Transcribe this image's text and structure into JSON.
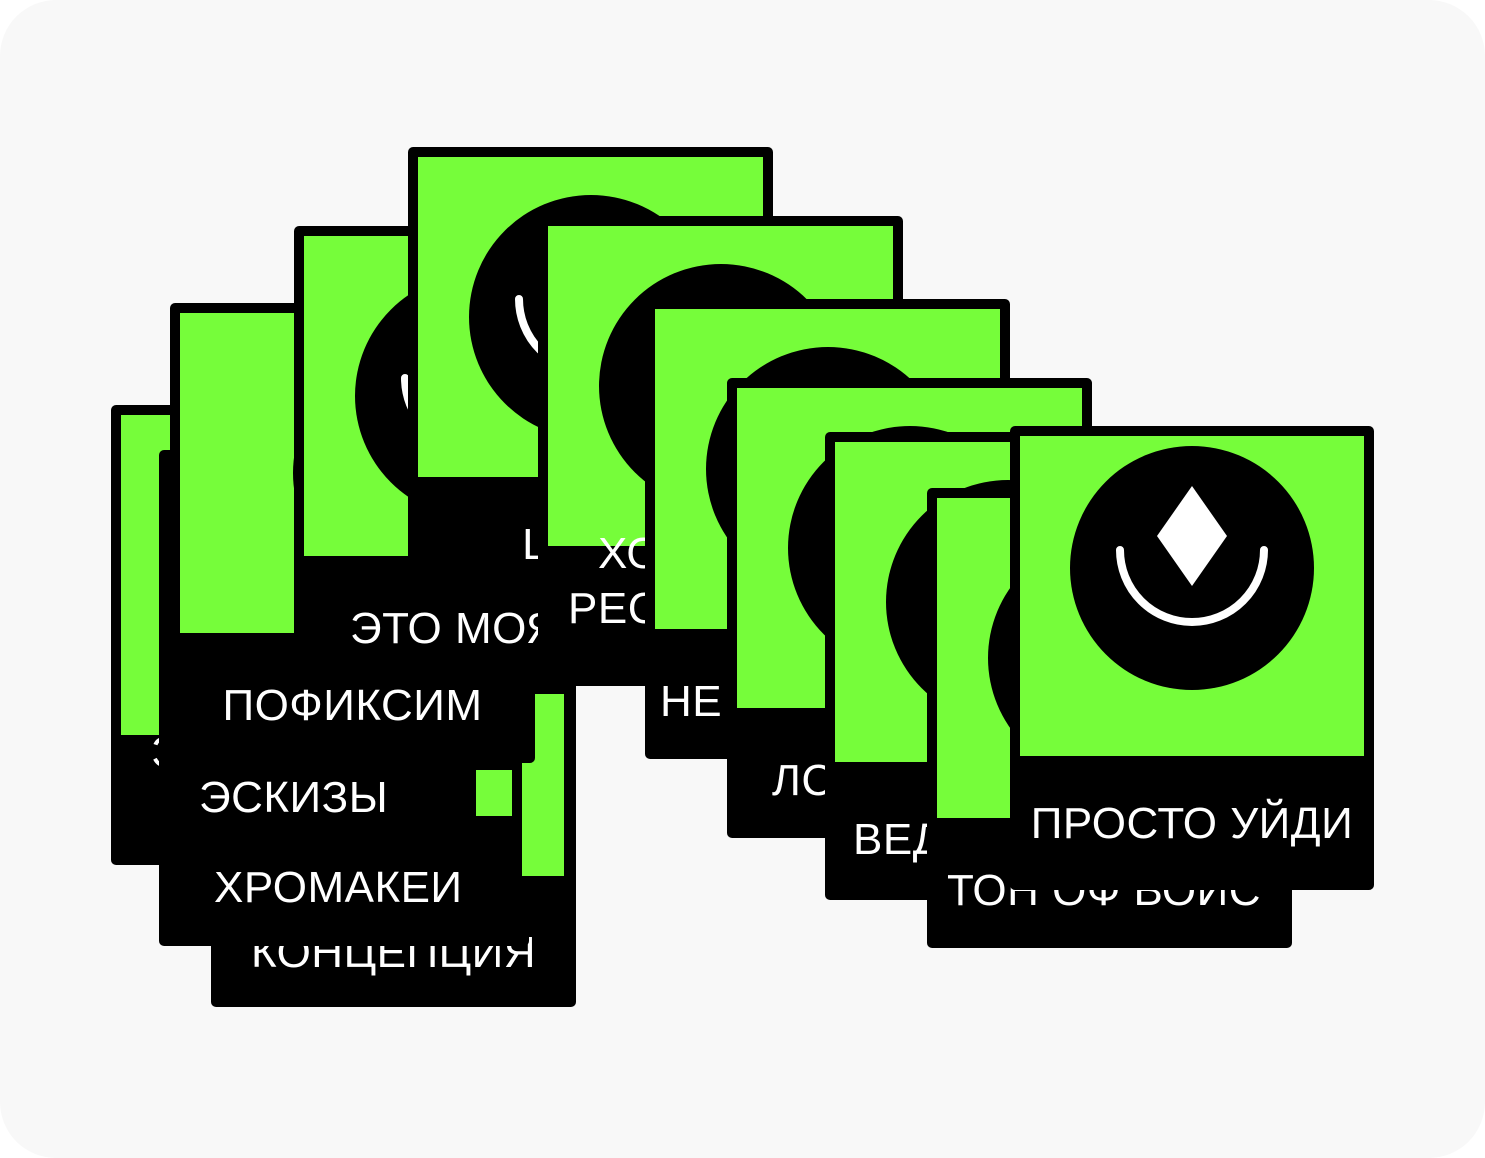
{
  "colors": {
    "accent": "#76fd3a",
    "card": "#000000",
    "panel": "#f8f8f8"
  },
  "icon": "smiling-face-with-diamond-icon",
  "cards": [
    {
      "label": "Э"
    },
    {
      "label": "ПОФИКСИМ"
    },
    {
      "label": "ЭТО МОЯ И"
    },
    {
      "label": "ШРИФ"
    },
    {
      "label": "ХО"
    },
    {
      "label": "РЕС"
    },
    {
      "label": "НЕ"
    },
    {
      "label": "ЛС"
    },
    {
      "label": "ВЕД"
    },
    {
      "label": "ТОН ОФ ВОИС"
    },
    {
      "label": "ПРОСТО УЙДИ"
    }
  ],
  "stack_labels": [
    "ЭСКИЗЫ",
    "ХРОМАКЕИ",
    "КОНЦЕПЦИЯ"
  ]
}
